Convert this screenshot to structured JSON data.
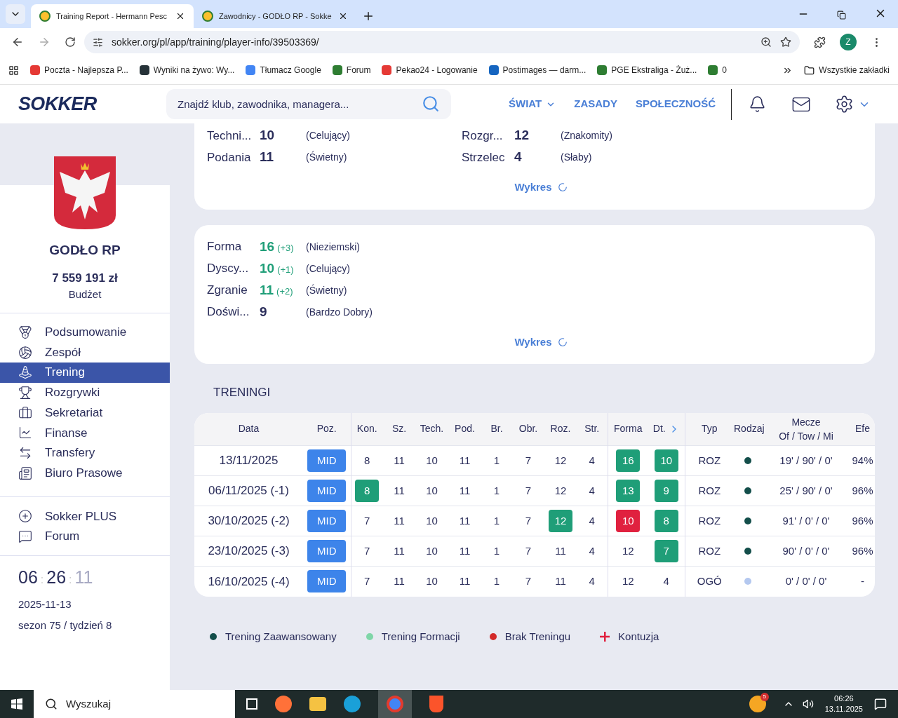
{
  "browser": {
    "tabs": [
      {
        "title": "Training Report - Hermann Pesc",
        "selected": true
      },
      {
        "title": "Zawodnicy - GODŁO RP - Sokke",
        "selected": false
      }
    ],
    "address": "sokker.org/pl/app/training/player-info/39503369/",
    "profile": "Z",
    "bookmarks": [
      "Poczta - Najlepsza P...",
      "Wyniki na żywo: Wy...",
      "Tłumacz Google",
      "Forum",
      "Pekao24 - Logowanie",
      "Postimages — darm...",
      "PGE Ekstraliga - Żuż...",
      "0"
    ],
    "all_bookmarks": "Wszystkie zakładki"
  },
  "header": {
    "logo": "SOKKER",
    "search": {
      "placeholder": "Znajdź klub, zawodnika, managera..."
    },
    "nav": [
      {
        "label": "ŚWIAT",
        "kind": "dropdown"
      },
      {
        "label": "ZASADY",
        "kind": "link"
      },
      {
        "label": "SPOŁECZNOŚĆ",
        "kind": "link"
      }
    ]
  },
  "sidebar": {
    "club": "GODŁO RP",
    "budget": "7 559 191 zł",
    "budget_label": "Budżet",
    "menu": [
      {
        "label": "Podsumowanie",
        "selected": false
      },
      {
        "label": "Zespół",
        "selected": false
      },
      {
        "label": "Trening",
        "selected": true
      },
      {
        "label": "Rozgrywki",
        "selected": false
      },
      {
        "label": "Sekretariat",
        "selected": false
      },
      {
        "label": "Finanse",
        "selected": false
      },
      {
        "label": "Transfery",
        "selected": false
      },
      {
        "label": "Biuro Prasowe",
        "selected": false
      }
    ],
    "extra": [
      {
        "label": "Sokker PLUS"
      },
      {
        "label": "Forum"
      }
    ],
    "clock": [
      {
        "text": "06",
        "kind": "digits"
      },
      {
        "text": ":",
        "kind": "sep"
      },
      {
        "text": "26",
        "kind": "digits"
      },
      {
        "text": ":",
        "kind": "sep"
      },
      {
        "text": "11",
        "kind": "faded"
      }
    ],
    "date": "2025-11-13",
    "season": "sezon 75 / tydzień 8"
  },
  "skills_card": {
    "rows": [
      [
        {
          "label": "Techni...",
          "value": "10",
          "desc": "(Celujący)"
        },
        {
          "label": "Rozgr...",
          "value": "12",
          "desc": "(Znakomity)"
        }
      ],
      [
        {
          "label": "Podania",
          "value": "11",
          "desc": "(Świetny)"
        },
        {
          "label": "Strzelec",
          "value": "4",
          "desc": "(Słaby)"
        }
      ]
    ],
    "link": "Wykres"
  },
  "form_card": {
    "rows": [
      {
        "label": "Forma",
        "value": "16",
        "change": "(+3)",
        "desc": "(Nieziemski)"
      },
      {
        "label": "Dyscy...",
        "value": "10",
        "change": "(+1)",
        "desc": "(Celujący)"
      },
      {
        "label": "Zgranie",
        "value": "11",
        "change": "(+2)",
        "desc": "(Świetny)"
      },
      {
        "label": "Doświ...",
        "value": "9",
        "desc": "(Bardzo Dobry)"
      }
    ],
    "link": "Wykres"
  },
  "trainings": {
    "title": "TRENINGI",
    "columns": [
      "Data",
      "Poz.",
      "Kon.",
      "Sz.",
      "Tech.",
      "Pod.",
      "Br.",
      "Obr.",
      "Roz.",
      "Str.",
      "Forma",
      "Dt.",
      "Typ",
      "Rodzaj",
      "Mecze",
      "Efe"
    ],
    "mecze_sub": "Of / Tow / Mi",
    "rows": [
      {
        "date": "13/11/2025",
        "pos": "MID",
        "values": [
          {
            "text": "8"
          },
          {
            "text": "11"
          },
          {
            "text": "10"
          },
          {
            "text": "11"
          },
          {
            "text": "1"
          },
          {
            "text": "7"
          },
          {
            "text": "12"
          },
          {
            "text": "4"
          },
          {
            "text": "16",
            "color": "#1f9e78"
          },
          {
            "text": "10",
            "color": "#1f9e78"
          }
        ],
        "type": "ROZ",
        "color": "#134e4a",
        "matches": "19' / 90' / 0'",
        "eff": "94%"
      },
      {
        "date": "06/11/2025 (-1)",
        "pos": "MID",
        "values": [
          {
            "text": "8",
            "color": "#1f9e78"
          },
          {
            "text": "11"
          },
          {
            "text": "10"
          },
          {
            "text": "11"
          },
          {
            "text": "1"
          },
          {
            "text": "7"
          },
          {
            "text": "12"
          },
          {
            "text": "4"
          },
          {
            "text": "13",
            "color": "#1f9e78"
          },
          {
            "text": "9",
            "color": "#1f9e78"
          }
        ],
        "type": "ROZ",
        "color": "#134e4a",
        "matches": "25' / 90' / 0'",
        "eff": "96%"
      },
      {
        "date": "30/10/2025 (-2)",
        "pos": "MID",
        "values": [
          {
            "text": "7"
          },
          {
            "text": "11"
          },
          {
            "text": "10"
          },
          {
            "text": "11"
          },
          {
            "text": "1"
          },
          {
            "text": "7"
          },
          {
            "text": "12",
            "color": "#1f9e78"
          },
          {
            "text": "4"
          },
          {
            "text": "10",
            "color": "#e0213f"
          },
          {
            "text": "8",
            "color": "#1f9e78"
          }
        ],
        "type": "ROZ",
        "color": "#134e4a",
        "matches": "91' / 0' / 0'",
        "eff": "96%"
      },
      {
        "date": "23/10/2025 (-3)",
        "pos": "MID",
        "values": [
          {
            "text": "7"
          },
          {
            "text": "11"
          },
          {
            "text": "10"
          },
          {
            "text": "11"
          },
          {
            "text": "1"
          },
          {
            "text": "7"
          },
          {
            "text": "11"
          },
          {
            "text": "4"
          },
          {
            "text": "12"
          },
          {
            "text": "7",
            "color": "#1f9e78"
          }
        ],
        "type": "ROZ",
        "color": "#134e4a",
        "matches": "90' / 0' / 0'",
        "eff": "96%"
      },
      {
        "date": "16/10/2025 (-4)",
        "pos": "MID",
        "values": [
          {
            "text": "7"
          },
          {
            "text": "11"
          },
          {
            "text": "10"
          },
          {
            "text": "11"
          },
          {
            "text": "1"
          },
          {
            "text": "7"
          },
          {
            "text": "11"
          },
          {
            "text": "4"
          },
          {
            "text": "12"
          },
          {
            "text": "4"
          }
        ],
        "type": "OGÓ",
        "color": "#b4c8ef",
        "matches": "0' / 0' / 0'",
        "eff": "-"
      }
    ]
  },
  "legend": [
    {
      "label": "Trening Zaawansowany",
      "kind": "dot",
      "color": "#134e4a"
    },
    {
      "label": "Trening Formacji",
      "kind": "dot",
      "color": "#7fd6a8"
    },
    {
      "label": "Brak Treningu",
      "kind": "dot",
      "color": "#d32a2a"
    },
    {
      "label": "Kontuzja",
      "kind": "cross",
      "color": "#e0213f"
    }
  ],
  "taskbar": {
    "search": "Wyszukaj",
    "badge": "5",
    "time": "06:26",
    "date": "13.11.2025"
  }
}
